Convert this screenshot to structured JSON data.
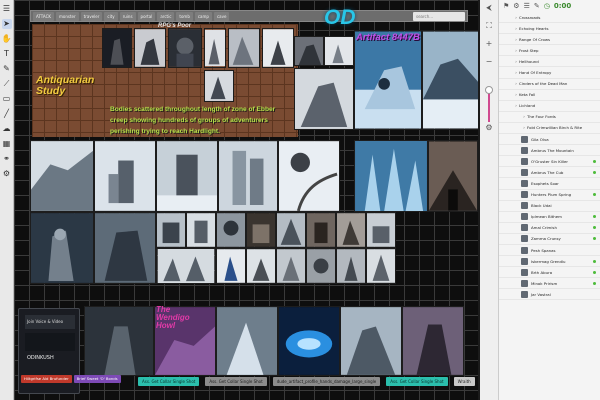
{
  "toolbar": {
    "tools": [
      {
        "name": "menu-icon",
        "glyph": "☰"
      },
      {
        "name": "pointer-icon",
        "glyph": "➤"
      },
      {
        "name": "hand-icon",
        "glyph": "✋"
      },
      {
        "name": "text-icon",
        "glyph": "T"
      },
      {
        "name": "pen-icon",
        "glyph": "✎"
      },
      {
        "name": "brush-icon",
        "glyph": "⟋"
      },
      {
        "name": "shape-icon",
        "glyph": "▭"
      },
      {
        "name": "line-icon",
        "glyph": "╱"
      },
      {
        "name": "cloud-icon",
        "glyph": "☁"
      },
      {
        "name": "image-icon",
        "glyph": "▦"
      },
      {
        "name": "link-icon",
        "glyph": "⚭"
      },
      {
        "name": "settings-icon",
        "glyph": "⚙"
      }
    ]
  },
  "board": {
    "tabs": [
      "ATTACK",
      "monster",
      "traveler",
      "city",
      "ruins",
      "portal",
      "arctic",
      "tomb",
      "camp",
      "cave"
    ],
    "search_placeholder": "search...",
    "title": "OD",
    "labels": {
      "rpg": "RPG's Poor",
      "artifact": "Artifact 8447B",
      "antiquarian": "Antiquarian Study",
      "description": "Bodies scattered throughout length of zone of Ebber creep showing hundreds of groups of adventurers perishing trying to reach Hardlight.",
      "wendigo": "The Wendigo Howl"
    },
    "tags": [
      {
        "text": "Ass. Get Collar Single Shot",
        "style": "teal"
      },
      {
        "text": "Ass. Get Collar Single Shot",
        "style": "gray"
      },
      {
        "text": "dude_artifact_profile_hands_damage_large_single",
        "style": "gray"
      },
      {
        "text": "Ass. Get Collar Single Shot",
        "style": "teal"
      },
      {
        "text": "Wraith",
        "style": "light"
      }
    ]
  },
  "overlay": {
    "header": "Join Voice & Video",
    "name": "ODINKUSH",
    "buttons": [
      {
        "label": "Hiltgrifse Ald Brufunder",
        "style": "red"
      },
      {
        "label": "Brief Sweet 'O' Bonds",
        "style": "purple"
      }
    ]
  },
  "sidebar": {
    "timer": "0:00",
    "items": [
      {
        "label": "Crossroads",
        "level": 1
      },
      {
        "label": "Echoing Hearts",
        "level": 1
      },
      {
        "label": "Range Of Crows",
        "level": 1
      },
      {
        "label": "Frost Step",
        "level": 1
      },
      {
        "label": "Hellhound",
        "level": 1
      },
      {
        "label": "Hand Of Entropy",
        "level": 1
      },
      {
        "label": "Cinders of the Dead Man",
        "level": 1
      },
      {
        "label": "Keta Fall",
        "level": 1
      },
      {
        "label": "Lichland",
        "level": 1
      },
      {
        "label": "The Four Fords",
        "level": 2
      },
      {
        "label": "Fold Crimwillian Birch & Rite",
        "level": 2
      },
      {
        "label": "Gila Olva",
        "level": 2,
        "thumb": true
      },
      {
        "label": "Ambrus The Mountain",
        "level": 2,
        "thumb": true
      },
      {
        "label": "O'Gruster Sin Killer",
        "level": 2,
        "thumb": true,
        "dot": true
      },
      {
        "label": "Ambrus The Cub",
        "level": 2,
        "thumb": true,
        "dot": true
      },
      {
        "label": "Esophets Soar",
        "level": 2,
        "thumb": true
      },
      {
        "label": "Hunters Plum Spring",
        "level": 2,
        "thumb": true,
        "dot": true
      },
      {
        "label": "Black Udai",
        "level": 2,
        "thumb": true
      },
      {
        "label": "Iplmean Bithem",
        "level": 2,
        "thumb": true,
        "dot": true
      },
      {
        "label": "Amal Crimish",
        "level": 2,
        "thumb": true,
        "dot": true
      },
      {
        "label": "Zamma Crunsy",
        "level": 2,
        "thumb": true,
        "dot": true
      },
      {
        "label": "Pesh Spanas",
        "level": 2,
        "thumb": true
      },
      {
        "label": "Iskermag Grendlu",
        "level": 2,
        "thumb": true,
        "dot": true
      },
      {
        "label": "Brth Abura",
        "level": 2,
        "thumb": true,
        "dot": true
      },
      {
        "label": "Minok Prirism",
        "level": 2,
        "thumb": true,
        "dot": true
      },
      {
        "label": "Jar Vastral",
        "level": 2,
        "thumb": true
      }
    ]
  }
}
